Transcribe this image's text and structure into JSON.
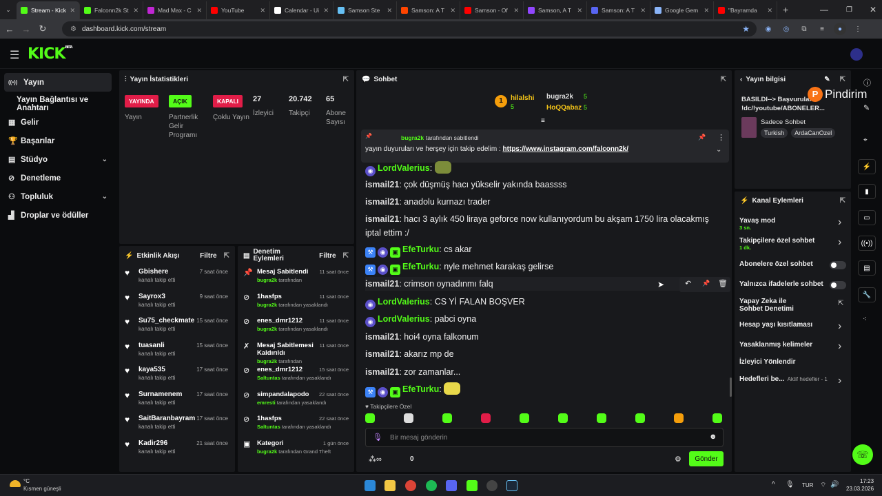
{
  "browser": {
    "tabs": [
      {
        "label": "Stream - Kick",
        "color": "#53fc18",
        "active": true
      },
      {
        "label": "Falconn2k St",
        "color": "#53fc18"
      },
      {
        "label": "Mad Max - C",
        "color": "#c026d3"
      },
      {
        "label": "YouTube",
        "color": "#ff0000"
      },
      {
        "label": "Calendar - Ui",
        "color": "#ffffff"
      },
      {
        "label": "Samson Ste",
        "color": "#66c0f4"
      },
      {
        "label": "Samson: A T",
        "color": "#ff4500"
      },
      {
        "label": "Samson - Of",
        "color": "#ff0000"
      },
      {
        "label": "Samson, A T",
        "color": "#9146ff"
      },
      {
        "label": "Samson: A T",
        "color": "#5865f2"
      },
      {
        "label": "Google Gem",
        "color": "#8ab4f8"
      },
      {
        "label": "\"Bayramda",
        "color": "#ff0000"
      }
    ],
    "url": "dashboard.kick.com/stream"
  },
  "app": {
    "logo": "KICK",
    "logo_beta": "BETA"
  },
  "sidebar": {
    "items": [
      {
        "label": "Yayın",
        "icon": "broadcast-icon",
        "active": true
      },
      {
        "label": "Yayın Bağlantısı ve Anahtarı",
        "icon": ""
      },
      {
        "label": "Gelir",
        "icon": "revenue-icon"
      },
      {
        "label": "Başarılar",
        "icon": "trophy-icon"
      },
      {
        "label": "Stüdyo",
        "icon": "studio-icon",
        "chevron": true
      },
      {
        "label": "Denetleme",
        "icon": "moderation-icon"
      },
      {
        "label": "Topluluk",
        "icon": "community-icon",
        "chevron": true
      },
      {
        "label": "Droplar ve ödüller",
        "icon": "gift-icon"
      }
    ]
  },
  "stats": {
    "title": "Yayın İstatistikleri",
    "items": [
      {
        "badge": "YAYINDA",
        "badge_color": "#e11d48",
        "label": "Yayın"
      },
      {
        "badge": "AÇIK",
        "badge_color": "#53fc18",
        "label": "Partnerlik Gelir Programı"
      },
      {
        "badge": "KAPALI",
        "badge_color": "#e11d48",
        "label": "Çoklu Yayın"
      }
    ],
    "numbers": [
      {
        "value": "27",
        "label": "İzleyici"
      },
      {
        "value": "20.742",
        "label": "Takipçi"
      },
      {
        "value": "65",
        "label": "Abone Sayısı"
      }
    ]
  },
  "activity": {
    "title": "Etkinlik Akışı",
    "filter": "Filtre",
    "rows": [
      {
        "name": "Gbishere",
        "sub": "kanalı takip etti",
        "time": "7 saat önce"
      },
      {
        "name": "Sayrox3",
        "sub": "kanalı takip etti",
        "time": "9 saat önce"
      },
      {
        "name": "Su75_checkmate",
        "sub": "kanalı takip etti",
        "time": "15 saat önce"
      },
      {
        "name": "tuasanli",
        "sub": "kanalı takip etti",
        "time": "15 saat önce"
      },
      {
        "name": "kaya535",
        "sub": "kanalı takip etti",
        "time": "17 saat önce"
      },
      {
        "name": "Surnamenem",
        "sub": "kanalı takip etti",
        "time": "17 saat önce"
      },
      {
        "name": "SaitBaranbayram",
        "sub": "kanalı takip etti",
        "time": "17 saat önce"
      },
      {
        "name": "Kadir296",
        "sub": "kanalı takip etti",
        "time": "21 saat önce"
      }
    ]
  },
  "moderation": {
    "title": "Denetim Eylemleri",
    "filter": "Filtre",
    "rows": [
      {
        "icon": "pin-icon",
        "name": "Mesaj Sabitlendi",
        "by": "bugra2k",
        "action": "tarafından",
        "time": "11 saat önce"
      },
      {
        "icon": "ban-icon",
        "name": "1hasfps",
        "by": "bugra2k",
        "action": "tarafından yasaklandı",
        "time": "11 saat önce"
      },
      {
        "icon": "ban-icon",
        "name": "enes_dmr1212",
        "by": "bugra2k",
        "action": "tarafından yasaklandı",
        "time": "11 saat önce"
      },
      {
        "icon": "unpin-icon",
        "name": "Mesaj Sabitlemesi Kaldırıldı",
        "by": "bugra2k",
        "action": "tarafından",
        "time": "11 saat önce"
      },
      {
        "icon": "ban-icon",
        "name": "enes_dmr1212",
        "by": "Saltuntas",
        "action": "tarafından yasaklandı",
        "time": "15 saat önce"
      },
      {
        "icon": "ban-icon",
        "name": "simpandalapodo",
        "by": "emresti",
        "action": "tarafından yasaklandı",
        "time": "22 saat önce"
      },
      {
        "icon": "ban-icon",
        "name": "1hasfps",
        "by": "Saltuntas",
        "action": "tarafından yasaklandı",
        "time": "22 saat önce"
      },
      {
        "icon": "category-icon",
        "name": "Kategori",
        "by": "bugra2k",
        "action": "tarafından Grand Theft",
        "time": "1 gün önce"
      }
    ]
  },
  "chat": {
    "title": "Sohbet",
    "top": [
      {
        "rank": "1",
        "name": "hilalshi",
        "count": "5"
      },
      {
        "name": "bugra2k",
        "count": "5"
      },
      {
        "name": "HoQQabaz",
        "count": "5"
      }
    ],
    "pinned": {
      "by": "bugra2k",
      "by_suffix": "tarafından sabitlendi",
      "text": "yayın duyuruları ve herşey için takip edelim : ",
      "link": "https://www.instagram.com/falconn2k/"
    },
    "messages": [
      {
        "user": "LordValerius",
        "green": true,
        "text": "",
        "emote": true
      },
      {
        "user": "ismail21",
        "text": "çok düşmüş hacı yükselir yakında baassss"
      },
      {
        "user": "ismail21",
        "text": "anadolu kurnazı trader"
      },
      {
        "user": "ismail21",
        "text": "hacı 3 aylık 450 liraya geforce now kullanıyordum bu akşam 1750 lira olacakmış iptal ettim :/"
      },
      {
        "user": "EfeTurku",
        "green": true,
        "text": "cs akar",
        "badges": true
      },
      {
        "user": "EfeTurku",
        "green": true,
        "text": "nyle mehmet karakaş gelirse",
        "badges": true
      },
      {
        "user": "ismail21",
        "text": "crimson oynadınmı falq",
        "hover": true
      },
      {
        "user": "LordValerius",
        "green": true,
        "text": "CS Yİ FALAN BOŞVER"
      },
      {
        "user": "LordValerius",
        "green": true,
        "text": "pabci oyna"
      },
      {
        "user": "ismail21",
        "text": "hoi4 oyna falkonum"
      },
      {
        "user": "ismail21",
        "text": "akarız mp de"
      },
      {
        "user": "ismail21",
        "text": "zor zamanlar..."
      },
      {
        "user": "EfeTurku",
        "green": true,
        "text": "",
        "emote": true,
        "badges": true
      }
    ],
    "followers_only": "Takipçilere Özel",
    "input_placeholder": "Bir mesaj gönderin",
    "points": "0",
    "send": "Gönder"
  },
  "stream_info": {
    "title": "Yayın bilgisi",
    "stream_title": "BASILDI--> Başvurular !dc/!youtube/ABONELER...",
    "category": "Sadece Sohbet",
    "tags": [
      "Turkish",
      "ArdaCanOzel"
    ],
    "overlay_brand": "Pindirim"
  },
  "channel_actions": {
    "title": "Kanal Eylemleri",
    "items": [
      {
        "label": "Yavaş mod",
        "sub": "3 sn.",
        "control": "chevron"
      },
      {
        "label": "Takipçilere özel sohbet",
        "sub": "1 dk.",
        "control": "chevron"
      },
      {
        "label": "Abonelere özel sohbet",
        "control": "toggle"
      },
      {
        "label": "Yalnızca ifadelerle sohbet",
        "control": "toggle"
      },
      {
        "label": "Yapay Zeka ile Sohbet Denetimi",
        "control": "external"
      },
      {
        "label": "Hesap yaşı kısıtlaması",
        "control": "chevron"
      },
      {
        "label": "Yasaklanmış kelimeler",
        "control": "chevron"
      },
      {
        "label": "İzleyici Yönlendir",
        "control": "none"
      },
      {
        "label": "Hedefleri be...",
        "sub_inline": "Aktif hedefler - 1",
        "control": "chevron"
      }
    ]
  },
  "taskbar": {
    "weather_temp": "°C",
    "weather": "Kısmen güneşli",
    "lang": "TUR",
    "time": "17:23",
    "date": "23.03.2026"
  }
}
